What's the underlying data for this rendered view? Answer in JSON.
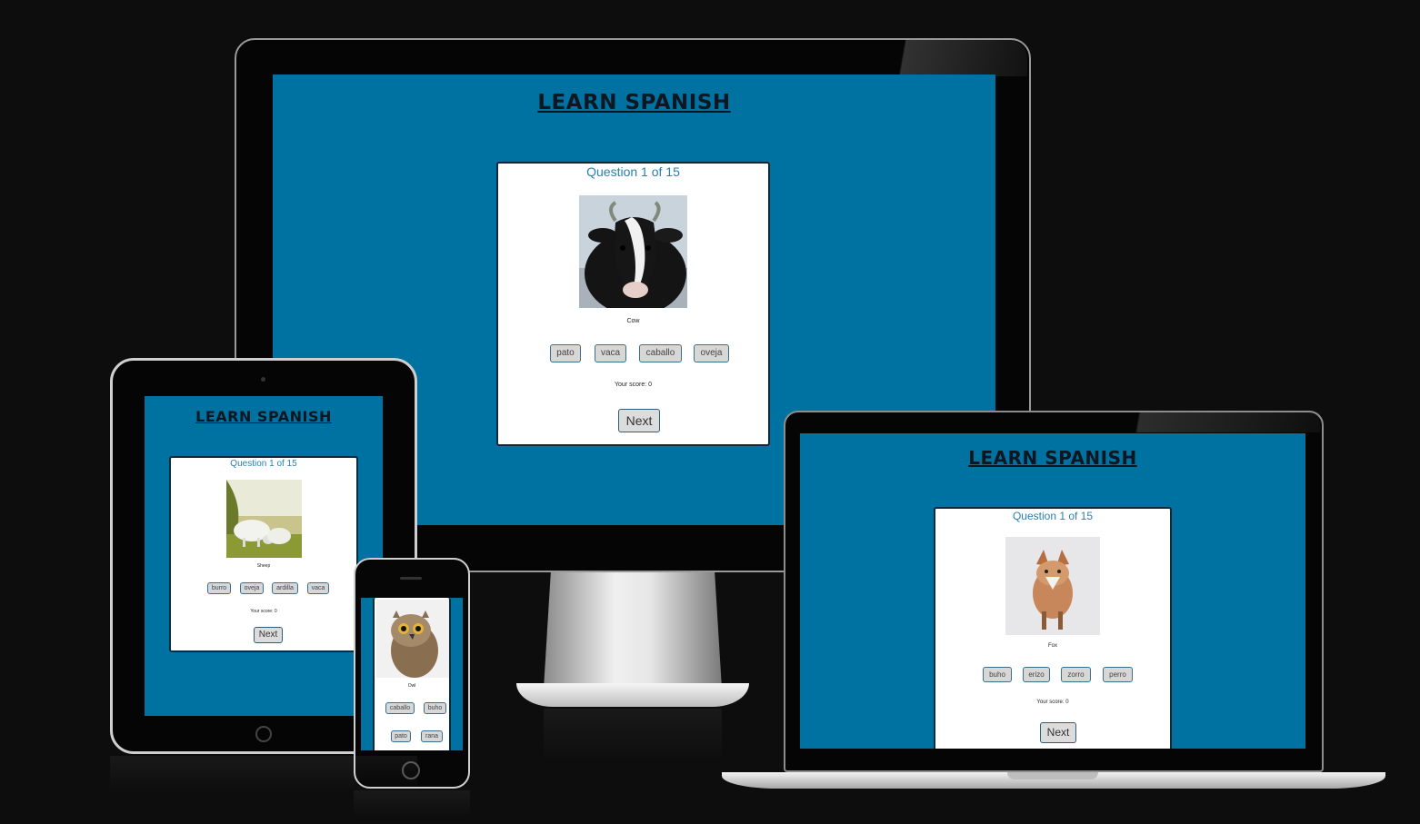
{
  "desktop": {
    "title": "LEARN SPANISH",
    "question": "Question 1 of 15",
    "animal": "Cow",
    "options": [
      "pato",
      "vaca",
      "caballo",
      "oveja"
    ],
    "score": "Your score: 0",
    "next": "Next"
  },
  "tablet": {
    "title": "LEARN SPANISH",
    "question": "Question 1 of 15",
    "animal": "Sheep",
    "options": [
      "burro",
      "oveja",
      "ardilla",
      "vaca"
    ],
    "score": "Your score: 0",
    "next": "Next"
  },
  "phone": {
    "animal": "Owl",
    "options": [
      "caballo",
      "buho",
      "pato",
      "rana"
    ]
  },
  "laptop": {
    "title": "LEARN SPANISH",
    "question": "Question 1 of 15",
    "animal": "Fox",
    "options": [
      "buho",
      "erizo",
      "zorro",
      "perro"
    ],
    "score": "Your score: 0",
    "next": "Next"
  },
  "colors": {
    "page_background": "#0d0d0e",
    "screen_background": "#0072a2",
    "question_text": "#2a7fae",
    "button_fill": "#d7d7d7"
  }
}
